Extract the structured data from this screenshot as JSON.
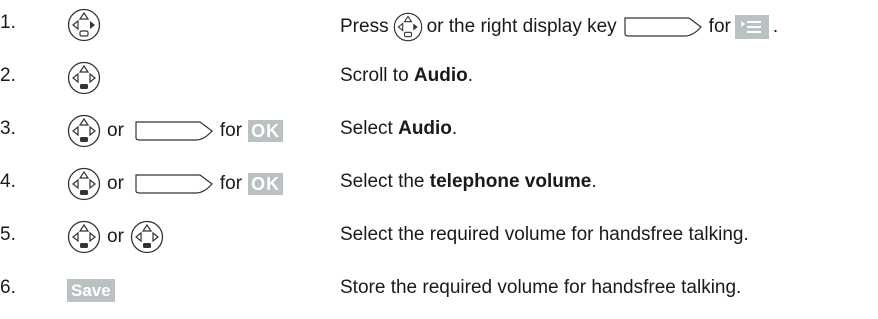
{
  "steps": [
    {
      "num": "1.",
      "desc_pre": "Press",
      "desc_mid": "or the right display key",
      "desc_post": "for",
      "desc_end": "."
    },
    {
      "num": "2.",
      "desc_pre": "Scroll to ",
      "desc_bold": "Audio",
      "desc_post": "."
    },
    {
      "num": "3.",
      "keys_or": "or",
      "keys_for": "for",
      "keys_ok": "OK",
      "desc_pre": "Select ",
      "desc_bold": "Audio",
      "desc_post": "."
    },
    {
      "num": "4.",
      "keys_or": "or",
      "keys_for": "for",
      "keys_ok": "OK",
      "desc_pre": "Select the ",
      "desc_bold": "telephone volume",
      "desc_post": "."
    },
    {
      "num": "5.",
      "keys_or": "or",
      "desc": "Select the required volume for handsfree talking."
    },
    {
      "num": "6.",
      "keys_label": "Save",
      "desc": "Store the required volume for handsfree talking."
    }
  ],
  "colors": {
    "key_highlight": "#b9c1c3",
    "text": "#1a1a1a"
  },
  "icons": {
    "nav": "navigation-key-icon",
    "softkey": "display-key-icon",
    "menu": "menu-icon"
  }
}
